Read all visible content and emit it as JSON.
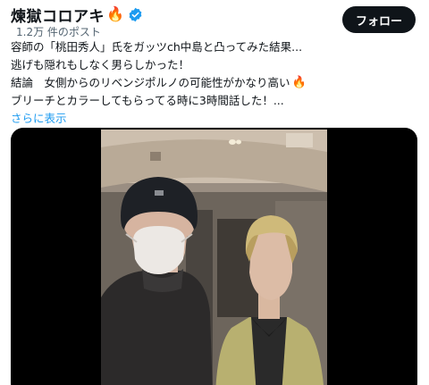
{
  "post": {
    "author": {
      "display_name": "煉獄コロアキ",
      "verified": true
    },
    "follow_button": "フォロー",
    "views": "1.2万 件のポスト",
    "text_lines": [
      "容師の「桃田秀人」氏をガッツch中島と凸ってみた結果...",
      "逃げも隠れもしなく男らしかった！",
      "結論　女側からのリベンジポルノの可能性がかなり高い",
      "ブリーチとカラーしてもらってる時に3時間話した！..."
    ],
    "show_more": "さらに表示"
  },
  "icons": {
    "fire": "fire-icon",
    "verified": "verified-badge-icon"
  },
  "colors": {
    "link": "#1d9bf0",
    "verified": "#1d9bf0",
    "button_bg": "#0f1419",
    "muted": "#536471"
  }
}
